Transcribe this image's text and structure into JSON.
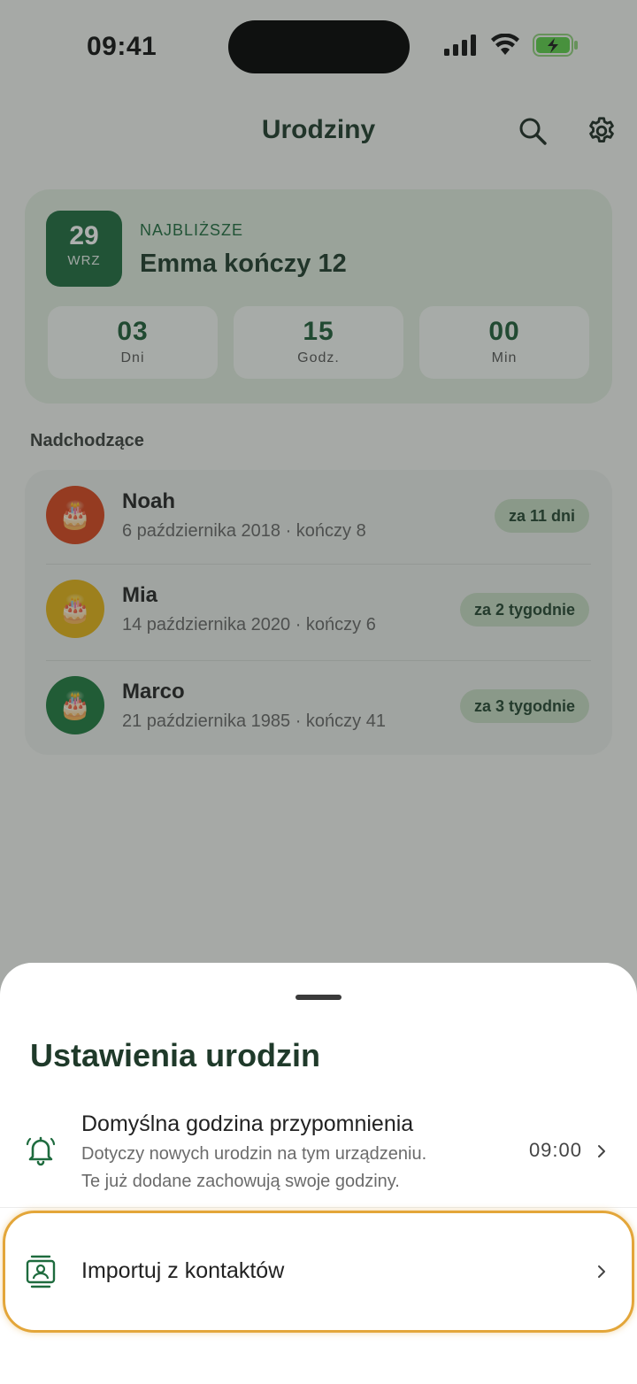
{
  "status_bar": {
    "time": "09:41"
  },
  "header": {
    "title": "Urodziny"
  },
  "next_birthday": {
    "day": "29",
    "month": "WRZ",
    "label": "NAJBLIŻSZE",
    "title": "Emma kończy 12",
    "countdown": [
      {
        "value": "03",
        "label": "Dni"
      },
      {
        "value": "15",
        "label": "Godz."
      },
      {
        "value": "00",
        "label": "Min"
      }
    ]
  },
  "upcoming": {
    "title": "Nadchodzące",
    "items": [
      {
        "name": "Noah",
        "detail": "6 października 2018 · kończy 8",
        "badge": "za 11 dni",
        "avatar_color": "#d9441c",
        "avatar_icon": "birthday-cake-icon"
      },
      {
        "name": "Mia",
        "detail": "14 października 2020 · kończy 6",
        "badge": "za 2 tygodnie",
        "avatar_color": "#e6b416",
        "avatar_icon": "birthday-cake-icon"
      },
      {
        "name": "Marco",
        "detail": "21 października 1985 · kończy 41",
        "badge": "za 3 tygodnie",
        "avatar_color": "#1d7a3e",
        "avatar_icon": "birthday-cake-icon"
      }
    ]
  },
  "sheet": {
    "title": "Ustawienia urodzin",
    "reminder": {
      "title": "Domyślna godzina przypomnienia",
      "desc_line1": "Dotyczy nowych urodzin na tym urządzeniu.",
      "desc_line2": "Te już dodane zachowują swoje godziny.",
      "value": "09:00",
      "icon": "bell-icon"
    },
    "import": {
      "title": "Importuj z kontaktów",
      "icon": "contacts-icon"
    }
  },
  "colors": {
    "accent": "#1e6b3e",
    "highlight_border": "#e3a63a"
  }
}
